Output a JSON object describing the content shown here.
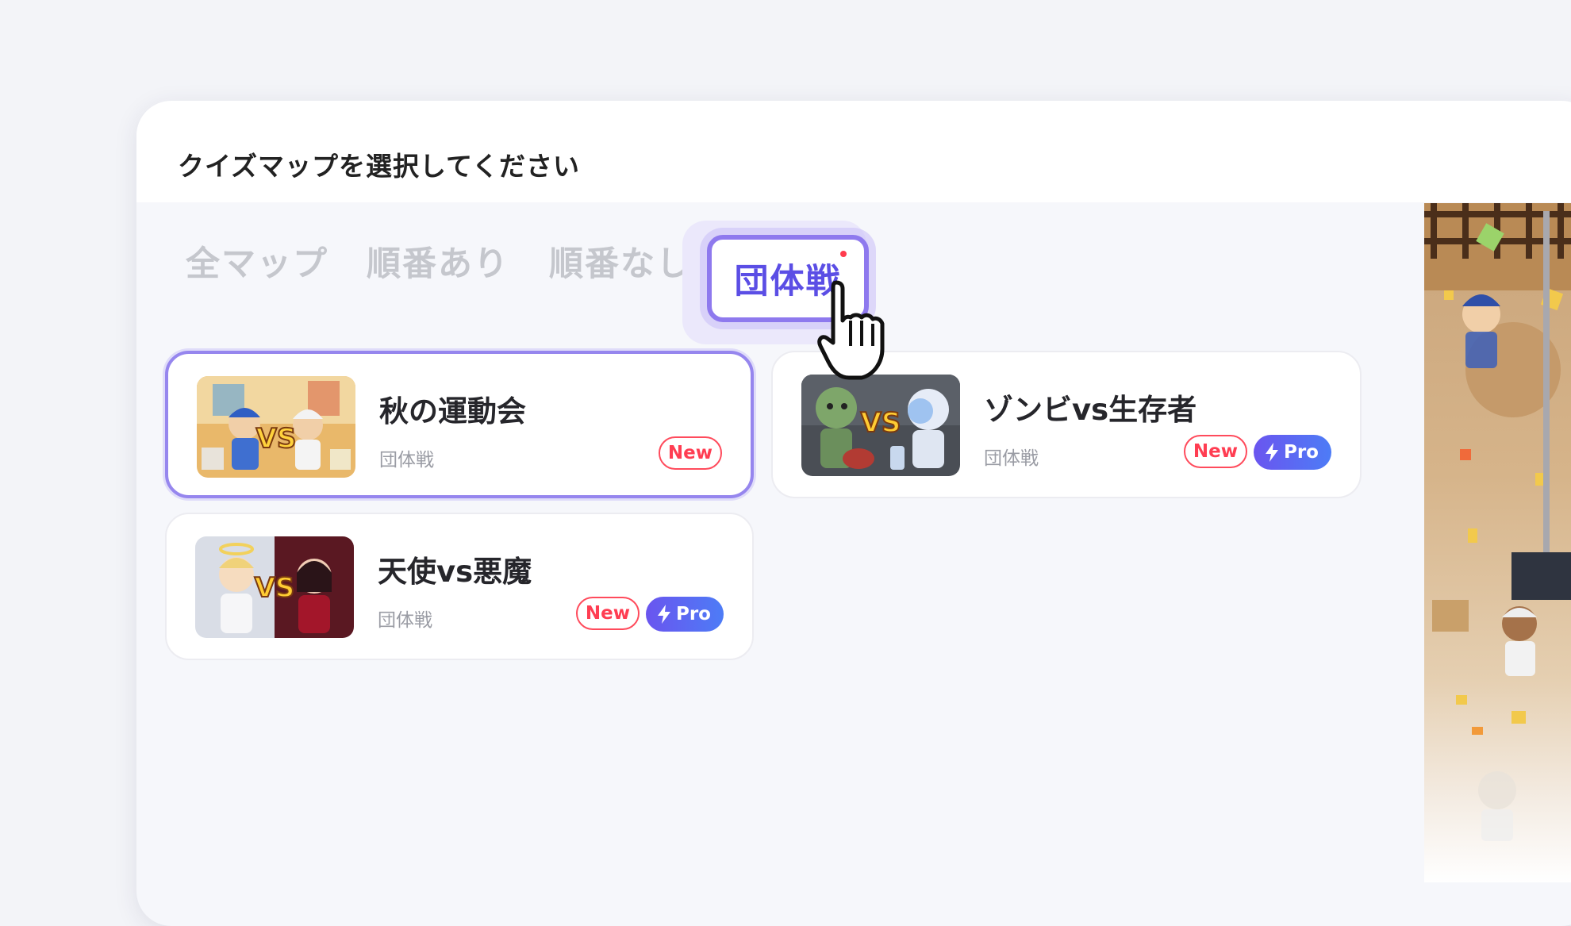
{
  "header": {
    "title": "クイズマップを選択してください"
  },
  "tabs": [
    {
      "label": "全マップ",
      "active": false
    },
    {
      "label": "順番あり",
      "active": false
    },
    {
      "label": "順番なし",
      "active": false
    },
    {
      "label": "団体戦",
      "active": true
    }
  ],
  "maps": [
    {
      "title": "秋の運動会",
      "category": "団体戦",
      "badges": {
        "new": "New"
      },
      "selected": true
    },
    {
      "title": "ゾンビvs生存者",
      "category": "団体戦",
      "badges": {
        "new": "New",
        "pro": "Pro"
      },
      "selected": false
    },
    {
      "title": "天使vs悪魔",
      "category": "団体戦",
      "badges": {
        "new": "New",
        "pro": "Pro"
      },
      "selected": false
    }
  ],
  "thumbnail_text": "VS",
  "colors": {
    "accent": "#5b4ee5",
    "tab_border": "#8e79ee",
    "new_badge": "#ff3d52",
    "pro_badge_start": "#6a55ef",
    "pro_badge_end": "#4d7cf6"
  },
  "icons": [
    "pointer-hand-icon",
    "lightning-icon"
  ]
}
